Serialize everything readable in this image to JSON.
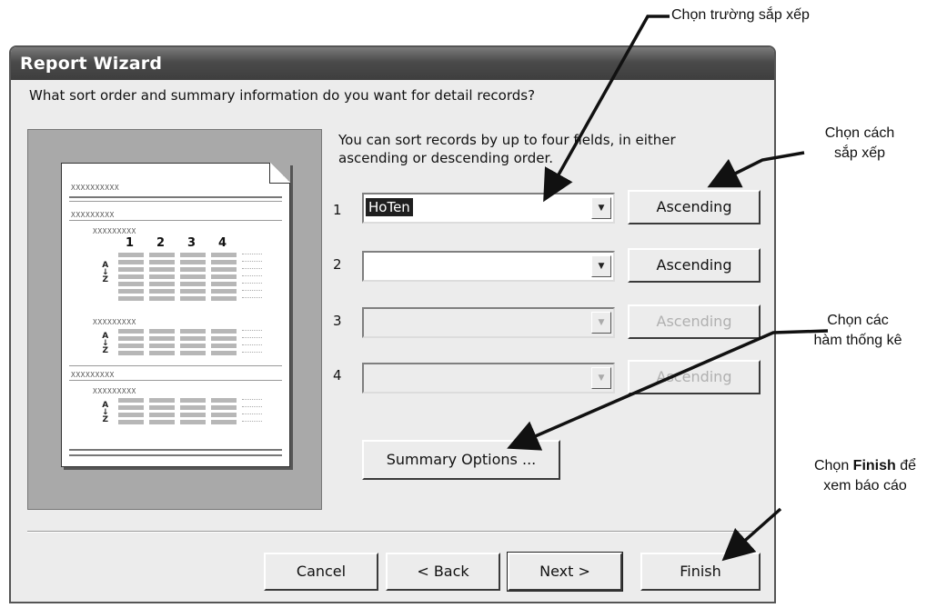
{
  "window": {
    "title": "Report Wizard"
  },
  "question": "What sort order and summary information do you want for detail records?",
  "preview": {
    "headers": [
      "XXXXXXXXXX",
      "XXXXXXXXX",
      "XXXXXXXXX"
    ],
    "column_numbers": [
      "1",
      "2",
      "3",
      "4"
    ],
    "az": [
      "A",
      "↓",
      "Z"
    ]
  },
  "instructions": "You can sort records by up to four fields, in either ascending or descending order.",
  "sort_rows": [
    {
      "number": "1",
      "value": "HoTen",
      "button": "Ascending",
      "enabled": true
    },
    {
      "number": "2",
      "value": "",
      "button": "Ascending",
      "enabled": true
    },
    {
      "number": "3",
      "value": "",
      "button": "Ascending",
      "enabled": false
    },
    {
      "number": "4",
      "value": "",
      "button": "Ascending",
      "enabled": false
    }
  ],
  "summary_button": "Summary Options ...",
  "footer": {
    "cancel": "Cancel",
    "back": "< Back",
    "next": "Next >",
    "finish": "Finish"
  },
  "annotations": {
    "field": "Chọn trường sắp xếp",
    "order_line1": "Chọn cách",
    "order_line2": "sắp xếp",
    "stats_line1": "Chọn các",
    "stats_line2": "hàm thống kê",
    "finish_pre": "Chọn ",
    "finish_bold": "Finish",
    "finish_post": " để",
    "finish_line2": "xem báo cáo"
  }
}
